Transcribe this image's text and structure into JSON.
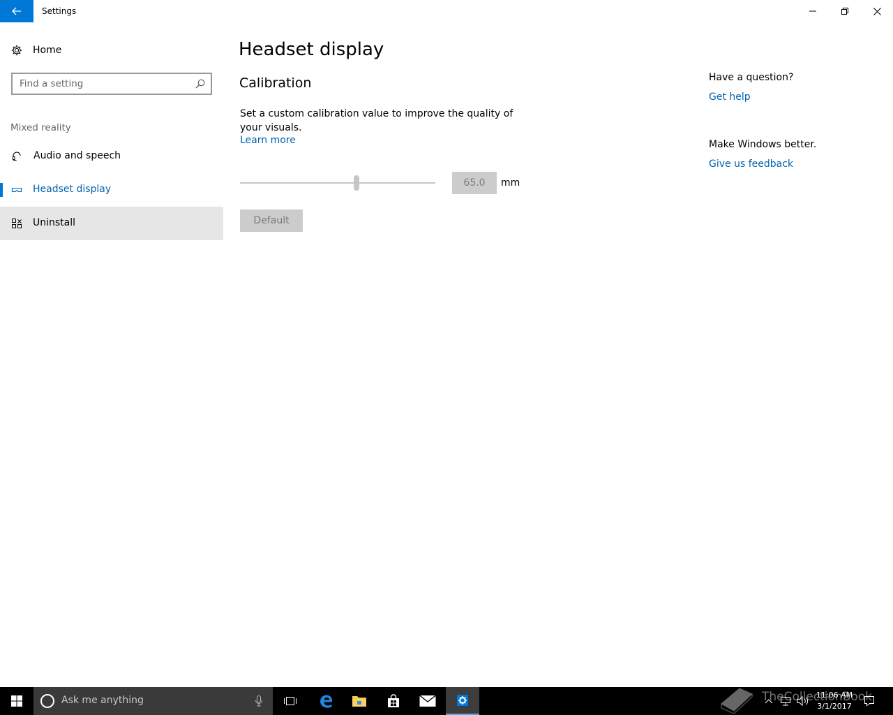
{
  "window": {
    "title": "Settings"
  },
  "sidebar": {
    "home_label": "Home",
    "search_placeholder": "Find a setting",
    "section_label": "Mixed reality",
    "items": [
      {
        "label": "Audio and speech",
        "icon": "headset-icon"
      },
      {
        "label": "Headset display",
        "icon": "vr-headset-icon",
        "selected": true
      },
      {
        "label": "Uninstall",
        "icon": "uninstall-icon",
        "hovered": true
      }
    ]
  },
  "main": {
    "page_title": "Headset display",
    "section_title": "Calibration",
    "description": "Set a custom calibration value to improve the quality of your visuals.",
    "learn_more": "Learn more",
    "slider_fraction": 0.6,
    "calibration_value": "65.0",
    "unit": "mm",
    "default_button": "Default"
  },
  "related": {
    "question": "Have a question?",
    "get_help": "Get help",
    "better": "Make Windows better.",
    "feedback": "Give us feedback"
  },
  "taskbar": {
    "search_text": "Ask me anything",
    "time": "11:06 AM",
    "date": "3/1/2017",
    "watermark": "TheCollectionBook"
  },
  "colors": {
    "accent": "#0078d7",
    "link": "#0063b1",
    "disabled_bg": "#cccccc",
    "taskbar_bg": "#000000"
  }
}
